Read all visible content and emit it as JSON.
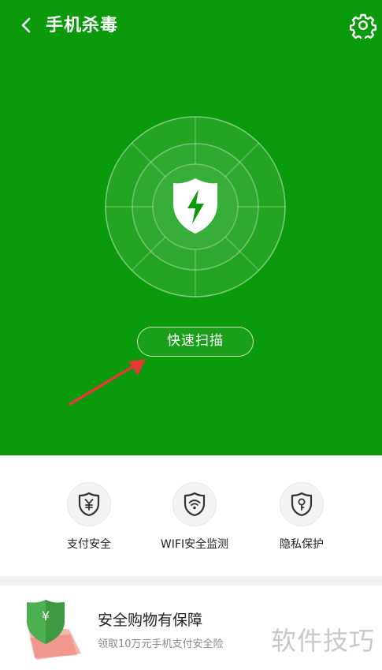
{
  "header": {
    "title": "手机杀毒",
    "back_icon": "chevron-left-icon",
    "settings_icon": "gear-icon"
  },
  "hero": {
    "background_color": "#0b9a0b",
    "center_icon": "shield-bolt-icon",
    "scan_button_label": "快速扫描"
  },
  "features": [
    {
      "label": "支付安全",
      "icon": "shield-yuan-icon"
    },
    {
      "label": "WIFI安全监测",
      "icon": "shield-wifi-icon"
    },
    {
      "label": "隐私保护",
      "icon": "shield-key-icon"
    }
  ],
  "promo": {
    "title": "安全购物有保障",
    "subtitle": "领取10万元手机支付安全险",
    "watermark": "软件技巧"
  }
}
